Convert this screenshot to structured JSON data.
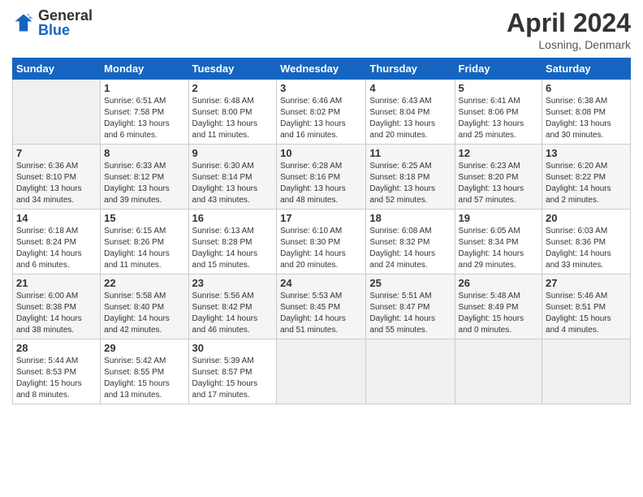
{
  "header": {
    "logo_general": "General",
    "logo_blue": "Blue",
    "month": "April 2024",
    "location": "Losning, Denmark"
  },
  "weekdays": [
    "Sunday",
    "Monday",
    "Tuesday",
    "Wednesday",
    "Thursday",
    "Friday",
    "Saturday"
  ],
  "weeks": [
    [
      {
        "num": "",
        "info": ""
      },
      {
        "num": "1",
        "info": "Sunrise: 6:51 AM\nSunset: 7:58 PM\nDaylight: 13 hours\nand 6 minutes."
      },
      {
        "num": "2",
        "info": "Sunrise: 6:48 AM\nSunset: 8:00 PM\nDaylight: 13 hours\nand 11 minutes."
      },
      {
        "num": "3",
        "info": "Sunrise: 6:46 AM\nSunset: 8:02 PM\nDaylight: 13 hours\nand 16 minutes."
      },
      {
        "num": "4",
        "info": "Sunrise: 6:43 AM\nSunset: 8:04 PM\nDaylight: 13 hours\nand 20 minutes."
      },
      {
        "num": "5",
        "info": "Sunrise: 6:41 AM\nSunset: 8:06 PM\nDaylight: 13 hours\nand 25 minutes."
      },
      {
        "num": "6",
        "info": "Sunrise: 6:38 AM\nSunset: 8:08 PM\nDaylight: 13 hours\nand 30 minutes."
      }
    ],
    [
      {
        "num": "7",
        "info": "Sunrise: 6:36 AM\nSunset: 8:10 PM\nDaylight: 13 hours\nand 34 minutes."
      },
      {
        "num": "8",
        "info": "Sunrise: 6:33 AM\nSunset: 8:12 PM\nDaylight: 13 hours\nand 39 minutes."
      },
      {
        "num": "9",
        "info": "Sunrise: 6:30 AM\nSunset: 8:14 PM\nDaylight: 13 hours\nand 43 minutes."
      },
      {
        "num": "10",
        "info": "Sunrise: 6:28 AM\nSunset: 8:16 PM\nDaylight: 13 hours\nand 48 minutes."
      },
      {
        "num": "11",
        "info": "Sunrise: 6:25 AM\nSunset: 8:18 PM\nDaylight: 13 hours\nand 52 minutes."
      },
      {
        "num": "12",
        "info": "Sunrise: 6:23 AM\nSunset: 8:20 PM\nDaylight: 13 hours\nand 57 minutes."
      },
      {
        "num": "13",
        "info": "Sunrise: 6:20 AM\nSunset: 8:22 PM\nDaylight: 14 hours\nand 2 minutes."
      }
    ],
    [
      {
        "num": "14",
        "info": "Sunrise: 6:18 AM\nSunset: 8:24 PM\nDaylight: 14 hours\nand 6 minutes."
      },
      {
        "num": "15",
        "info": "Sunrise: 6:15 AM\nSunset: 8:26 PM\nDaylight: 14 hours\nand 11 minutes."
      },
      {
        "num": "16",
        "info": "Sunrise: 6:13 AM\nSunset: 8:28 PM\nDaylight: 14 hours\nand 15 minutes."
      },
      {
        "num": "17",
        "info": "Sunrise: 6:10 AM\nSunset: 8:30 PM\nDaylight: 14 hours\nand 20 minutes."
      },
      {
        "num": "18",
        "info": "Sunrise: 6:08 AM\nSunset: 8:32 PM\nDaylight: 14 hours\nand 24 minutes."
      },
      {
        "num": "19",
        "info": "Sunrise: 6:05 AM\nSunset: 8:34 PM\nDaylight: 14 hours\nand 29 minutes."
      },
      {
        "num": "20",
        "info": "Sunrise: 6:03 AM\nSunset: 8:36 PM\nDaylight: 14 hours\nand 33 minutes."
      }
    ],
    [
      {
        "num": "21",
        "info": "Sunrise: 6:00 AM\nSunset: 8:38 PM\nDaylight: 14 hours\nand 38 minutes."
      },
      {
        "num": "22",
        "info": "Sunrise: 5:58 AM\nSunset: 8:40 PM\nDaylight: 14 hours\nand 42 minutes."
      },
      {
        "num": "23",
        "info": "Sunrise: 5:56 AM\nSunset: 8:42 PM\nDaylight: 14 hours\nand 46 minutes."
      },
      {
        "num": "24",
        "info": "Sunrise: 5:53 AM\nSunset: 8:45 PM\nDaylight: 14 hours\nand 51 minutes."
      },
      {
        "num": "25",
        "info": "Sunrise: 5:51 AM\nSunset: 8:47 PM\nDaylight: 14 hours\nand 55 minutes."
      },
      {
        "num": "26",
        "info": "Sunrise: 5:48 AM\nSunset: 8:49 PM\nDaylight: 15 hours\nand 0 minutes."
      },
      {
        "num": "27",
        "info": "Sunrise: 5:46 AM\nSunset: 8:51 PM\nDaylight: 15 hours\nand 4 minutes."
      }
    ],
    [
      {
        "num": "28",
        "info": "Sunrise: 5:44 AM\nSunset: 8:53 PM\nDaylight: 15 hours\nand 8 minutes."
      },
      {
        "num": "29",
        "info": "Sunrise: 5:42 AM\nSunset: 8:55 PM\nDaylight: 15 hours\nand 13 minutes."
      },
      {
        "num": "30",
        "info": "Sunrise: 5:39 AM\nSunset: 8:57 PM\nDaylight: 15 hours\nand 17 minutes."
      },
      {
        "num": "",
        "info": ""
      },
      {
        "num": "",
        "info": ""
      },
      {
        "num": "",
        "info": ""
      },
      {
        "num": "",
        "info": ""
      }
    ]
  ]
}
